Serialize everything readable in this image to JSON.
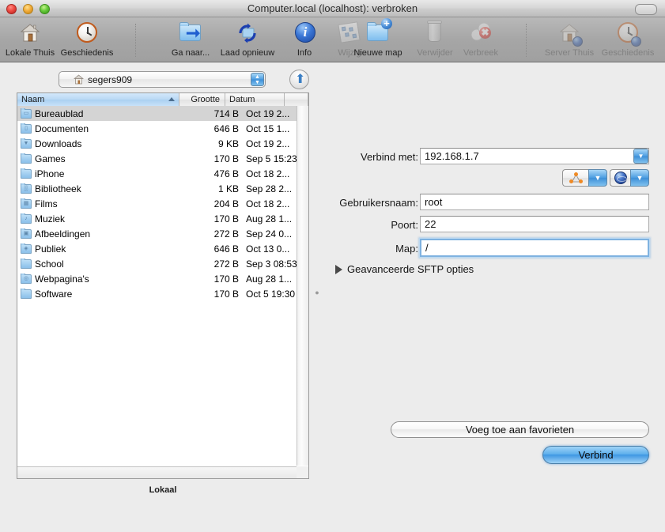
{
  "window": {
    "title": "Computer.local (localhost): verbroken",
    "traffic_lights": [
      "close-button",
      "minimize-button",
      "zoom-button"
    ]
  },
  "toolbar": {
    "items": [
      {
        "label": "Lokale Thuis",
        "icon": "house-icon",
        "disabled": false
      },
      {
        "label": "Geschiedenis",
        "icon": "clock-icon",
        "disabled": false
      },
      {
        "label": "Ga naar...",
        "icon": "goto-folder-icon",
        "disabled": false
      },
      {
        "label": "Laad opnieuw",
        "icon": "refresh-icon",
        "disabled": false
      },
      {
        "label": "Info",
        "icon": "info-icon",
        "disabled": false
      },
      {
        "label": "Wijzig",
        "icon": "edit-icon",
        "disabled": true
      },
      {
        "label": "Nieuwe map",
        "icon": "new-folder-icon",
        "disabled": false
      },
      {
        "label": "Verwijder",
        "icon": "trash-icon",
        "disabled": true
      },
      {
        "label": "Verbreek",
        "icon": "disconnect-icon",
        "disabled": true
      },
      {
        "label": "Server Thuis",
        "icon": "server-home-icon",
        "disabled": true
      },
      {
        "label": "Geschiedenis",
        "icon": "server-clock-icon",
        "disabled": true
      }
    ]
  },
  "left_pane": {
    "path_popup": {
      "value": "segers909",
      "icon": "home-icon"
    },
    "up_button": "up-arrow-button",
    "columns": [
      {
        "label": "Naam",
        "sorted": true,
        "sort_dir": "ascending"
      },
      {
        "label": "Grootte",
        "sorted": false,
        "sort_dir": ""
      },
      {
        "label": "Datum",
        "sorted": false,
        "sort_dir": ""
      }
    ],
    "rows": [
      {
        "name": "Bureaublad",
        "size": "714 B",
        "date": "Oct 19 2...",
        "icon": "desktop-folder-icon",
        "glyph": "▭",
        "selected": true
      },
      {
        "name": "Documenten",
        "size": "646 B",
        "date": "Oct 15 1...",
        "icon": "documents-folder-icon",
        "glyph": "▯",
        "selected": false
      },
      {
        "name": "Downloads",
        "size": "9 KB",
        "date": "Oct 19 2...",
        "icon": "downloads-folder-icon",
        "glyph": "▼",
        "selected": false
      },
      {
        "name": "Games",
        "size": "170 B",
        "date": "Sep 5 15:23",
        "icon": "folder-icon",
        "glyph": "",
        "selected": false
      },
      {
        "name": "iPhone",
        "size": "476 B",
        "date": "Oct 18 2...",
        "icon": "folder-icon",
        "glyph": "",
        "selected": false
      },
      {
        "name": "Bibliotheek",
        "size": "1 KB",
        "date": "Sep 28 2...",
        "icon": "library-folder-icon",
        "glyph": "▒",
        "selected": false
      },
      {
        "name": "Films",
        "size": "204 B",
        "date": "Oct 18 2...",
        "icon": "movies-folder-icon",
        "glyph": "▦",
        "selected": false
      },
      {
        "name": "Muziek",
        "size": "170 B",
        "date": "Aug 28 1...",
        "icon": "music-folder-icon",
        "glyph": "♪",
        "selected": false
      },
      {
        "name": "Afbeeldingen",
        "size": "272 B",
        "date": "Sep 24 0...",
        "icon": "pictures-folder-icon",
        "glyph": "▣",
        "selected": false
      },
      {
        "name": "Publiek",
        "size": "646 B",
        "date": "Oct 13 0...",
        "icon": "public-folder-icon",
        "glyph": "◈",
        "selected": false
      },
      {
        "name": "School",
        "size": "272 B",
        "date": "Sep 3 08:53",
        "icon": "folder-icon",
        "glyph": "",
        "selected": false
      },
      {
        "name": "Webpagina's",
        "size": "170 B",
        "date": "Aug 28 1...",
        "icon": "sites-folder-icon",
        "glyph": "◎",
        "selected": false
      },
      {
        "name": "Software",
        "size": "170 B",
        "date": "Oct 5 19:30",
        "icon": "folder-icon",
        "glyph": "",
        "selected": false
      }
    ],
    "footer_label": "Lokaal"
  },
  "connect_form": {
    "host": {
      "label": "Verbind met:",
      "value": "192.168.1.7"
    },
    "bonjour_button": {
      "icon": "bonjour-icon",
      "menu": "chevron-down-icon"
    },
    "globe_button": {
      "icon": "globe-icon",
      "menu": "chevron-down-icon"
    },
    "username": {
      "label": "Gebruikersnaam:",
      "value": "root"
    },
    "port": {
      "label": "Poort:",
      "value": "22"
    },
    "directory": {
      "label": "Map:",
      "value": "/"
    },
    "advanced": {
      "label": "Geavanceerde SFTP opties",
      "expanded": false
    },
    "add_favorite_button": "Voeg toe aan favorieten",
    "connect_button": "Verbind"
  },
  "colors": {
    "accent_blue": "#3d96e2",
    "selection_gray": "#d4d4d4",
    "sorted_header_blue": "#bad9f4",
    "toolbar_gray": "#a6a6a6"
  }
}
